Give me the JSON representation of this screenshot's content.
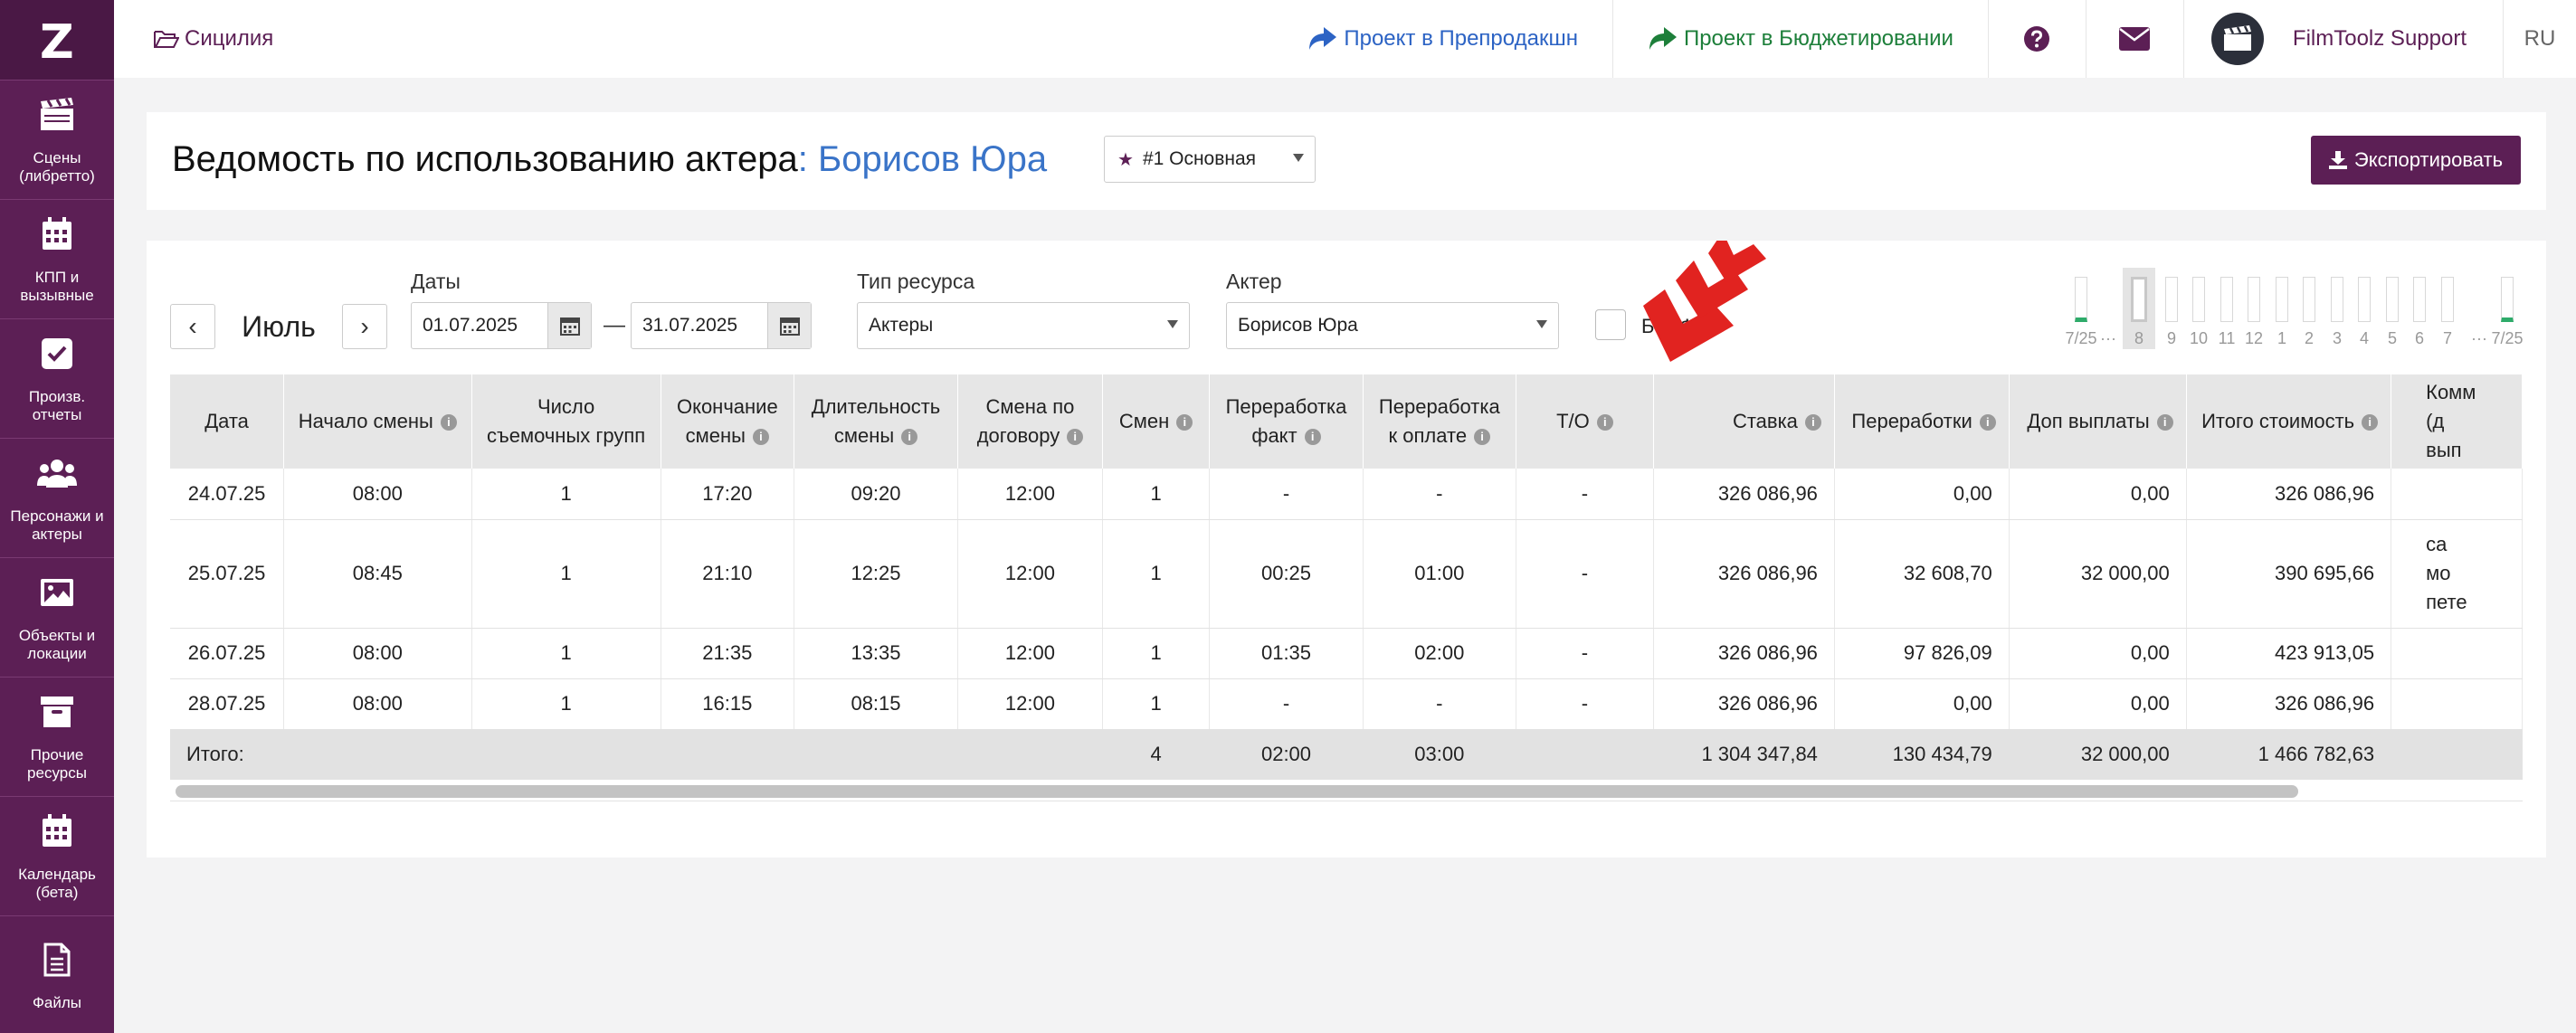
{
  "app": {
    "logo": "Z"
  },
  "sidebar": {
    "items": [
      {
        "label": "Сцены\n(либретто)",
        "icon": "clapperboard-icon"
      },
      {
        "label": "КПП и\nвызывные",
        "icon": "calendar-icon"
      },
      {
        "label": "Произв. отчеты",
        "icon": "checkbox-icon"
      },
      {
        "label": "Персонажи и\nактеры",
        "icon": "users-icon"
      },
      {
        "label": "Объекты и\nлокации",
        "icon": "image-icon"
      },
      {
        "label": "Прочие\nресурсы",
        "icon": "archive-icon"
      },
      {
        "label": "Календарь\n(бета)",
        "icon": "calendar-grid-icon"
      },
      {
        "label": "Файлы",
        "icon": "file-icon"
      }
    ]
  },
  "topbar": {
    "project": "Сицилия",
    "link_preprod": "Проект в Препродакшн",
    "link_budget": "Проект в Бюджетировании",
    "user": "FilmToolz Support",
    "lang": "RU"
  },
  "title": {
    "prefix": "Ведомость по использованию актера",
    "colon": ":",
    "actor": "Борисов Юра",
    "version": "#1 Основная",
    "export": "Экспортировать"
  },
  "filters": {
    "month": "Июль",
    "prev": "‹",
    "next": "›",
    "dates_label": "Даты",
    "date_from": "01.07.2025",
    "date_sep": "—",
    "date_to": "31.07.2025",
    "type_label": "Тип ресурса",
    "type_value": "Актеры",
    "actor_label": "Актер",
    "actor_value": "Борисов Юра",
    "no_fk": "Без ФК"
  },
  "mini_timeline": {
    "ticks": [
      "7/25",
      "···",
      "8",
      "9",
      "10",
      "11",
      "12",
      "1",
      "2",
      "3",
      "4",
      "5",
      "6",
      "7",
      "···",
      "7/25"
    ]
  },
  "table": {
    "headers": {
      "date": "Дата",
      "start": "Начало смены",
      "groups": "Число съемочных групп",
      "end": "Окончание смены",
      "duration": "Длительность смены",
      "contract": "Смена по договору",
      "shifts": "Смен",
      "ot_fact": "Переработка факт",
      "ot_pay": "Переработка к оплате",
      "to": "Т/О",
      "rate": "Ставка",
      "overtime": "Переработки",
      "extra": "Доп выплаты",
      "total": "Итого стоимость",
      "comment": "Комм\n(д\nвып"
    },
    "rows": [
      {
        "date": "24.07.25",
        "start": "08:00",
        "groups": "1",
        "end": "17:20",
        "duration": "09:20",
        "contract": "12:00",
        "shifts": "1",
        "ot_fact": "-",
        "ot_pay": "-",
        "to": "-",
        "rate": "326 086,96",
        "overtime": "0,00",
        "extra": "0,00",
        "total": "326 086,96",
        "comment": ""
      },
      {
        "date": "25.07.25",
        "start": "08:45",
        "groups": "1",
        "end": "21:10",
        "duration": "12:25",
        "contract": "12:00",
        "shifts": "1",
        "ot_fact": "00:25",
        "ot_pay": "01:00",
        "to": "-",
        "rate": "326 086,96",
        "overtime": "32 608,70",
        "extra": "32 000,00",
        "total": "390 695,66",
        "comment": "са\nмо\nпете"
      },
      {
        "date": "26.07.25",
        "start": "08:00",
        "groups": "1",
        "end": "21:35",
        "duration": "13:35",
        "contract": "12:00",
        "shifts": "1",
        "ot_fact": "01:35",
        "ot_pay": "02:00",
        "to": "-",
        "rate": "326 086,96",
        "overtime": "97 826,09",
        "extra": "0,00",
        "total": "423 913,05",
        "comment": ""
      },
      {
        "date": "28.07.25",
        "start": "08:00",
        "groups": "1",
        "end": "16:15",
        "duration": "08:15",
        "contract": "12:00",
        "shifts": "1",
        "ot_fact": "-",
        "ot_pay": "-",
        "to": "-",
        "rate": "326 086,96",
        "overtime": "0,00",
        "extra": "0,00",
        "total": "326 086,96",
        "comment": ""
      }
    ],
    "totals": {
      "label": "Итого:",
      "shifts": "4",
      "ot_fact": "02:00",
      "ot_pay": "03:00",
      "rate": "1 304 347,84",
      "overtime": "130 434,79",
      "extra": "32 000,00",
      "total": "1 466 782,63"
    },
    "info_glyph": "i"
  },
  "colors": {
    "brand": "#5c1f55",
    "link_blue": "#2c63c4",
    "link_green": "#1d7f3a",
    "accent_red": "#e02020"
  }
}
